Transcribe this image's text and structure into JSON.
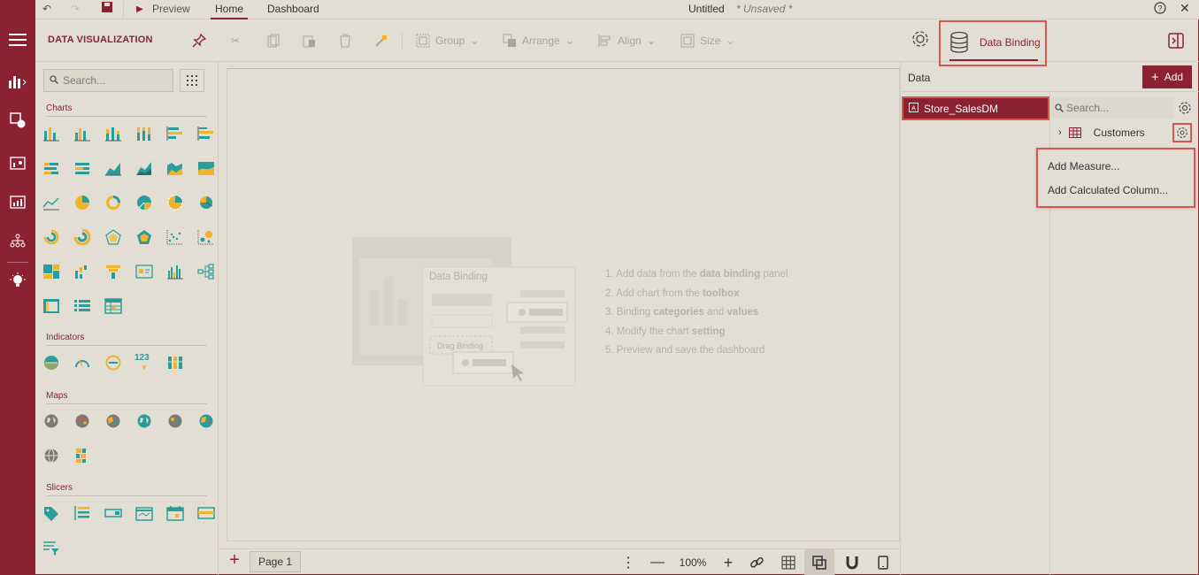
{
  "topbar": {
    "preview_label": "Preview",
    "tab_home": "Home",
    "tab_dashboard": "Dashboard",
    "doc_title": "Untitled",
    "unsaved": "* Unsaved *"
  },
  "toolbar": {
    "panel_title": "DATA VISUALIZATION",
    "group_label": "Group",
    "arrange_label": "Arrange",
    "align_label": "Align",
    "size_label": "Size",
    "data_binding_label": "Data Binding"
  },
  "toolbox": {
    "search_placeholder": "Search...",
    "sections": {
      "charts": "Charts",
      "indicators": "Indicators",
      "maps": "Maps",
      "slicers": "Slicers"
    },
    "indicator_number_glyph": "123"
  },
  "canvas": {
    "placeholder_title": "Data Binding",
    "placeholder_drag": "Drag Binding",
    "steps": [
      {
        "pre": "1. Add data from the ",
        "bold": "data binding",
        "post": " panel"
      },
      {
        "pre": "2. Add chart from the ",
        "bold": "toolbox",
        "post": ""
      },
      {
        "pre": "3. Binding ",
        "bold": "categories",
        "mid": " and ",
        "bold2": "values"
      },
      {
        "pre": "4. Modify the chart ",
        "bold": "setting",
        "post": ""
      },
      {
        "pre": "5. Preview and save the dashboard",
        "bold": "",
        "post": ""
      }
    ]
  },
  "bottombar": {
    "page_tab": "Page 1",
    "zoom": "100%"
  },
  "data_panel": {
    "header": "Data",
    "add_label": "Add",
    "datasource": "Store_SalesDM",
    "search_placeholder": "Search...",
    "table": "Customers",
    "context_menu": [
      "Add Measure...",
      "Add Calculated Column..."
    ]
  },
  "colors": {
    "brand": "#8b2232",
    "highlight": "#d9534f",
    "teal": "#2a9d9a",
    "gold": "#f0b32b"
  }
}
